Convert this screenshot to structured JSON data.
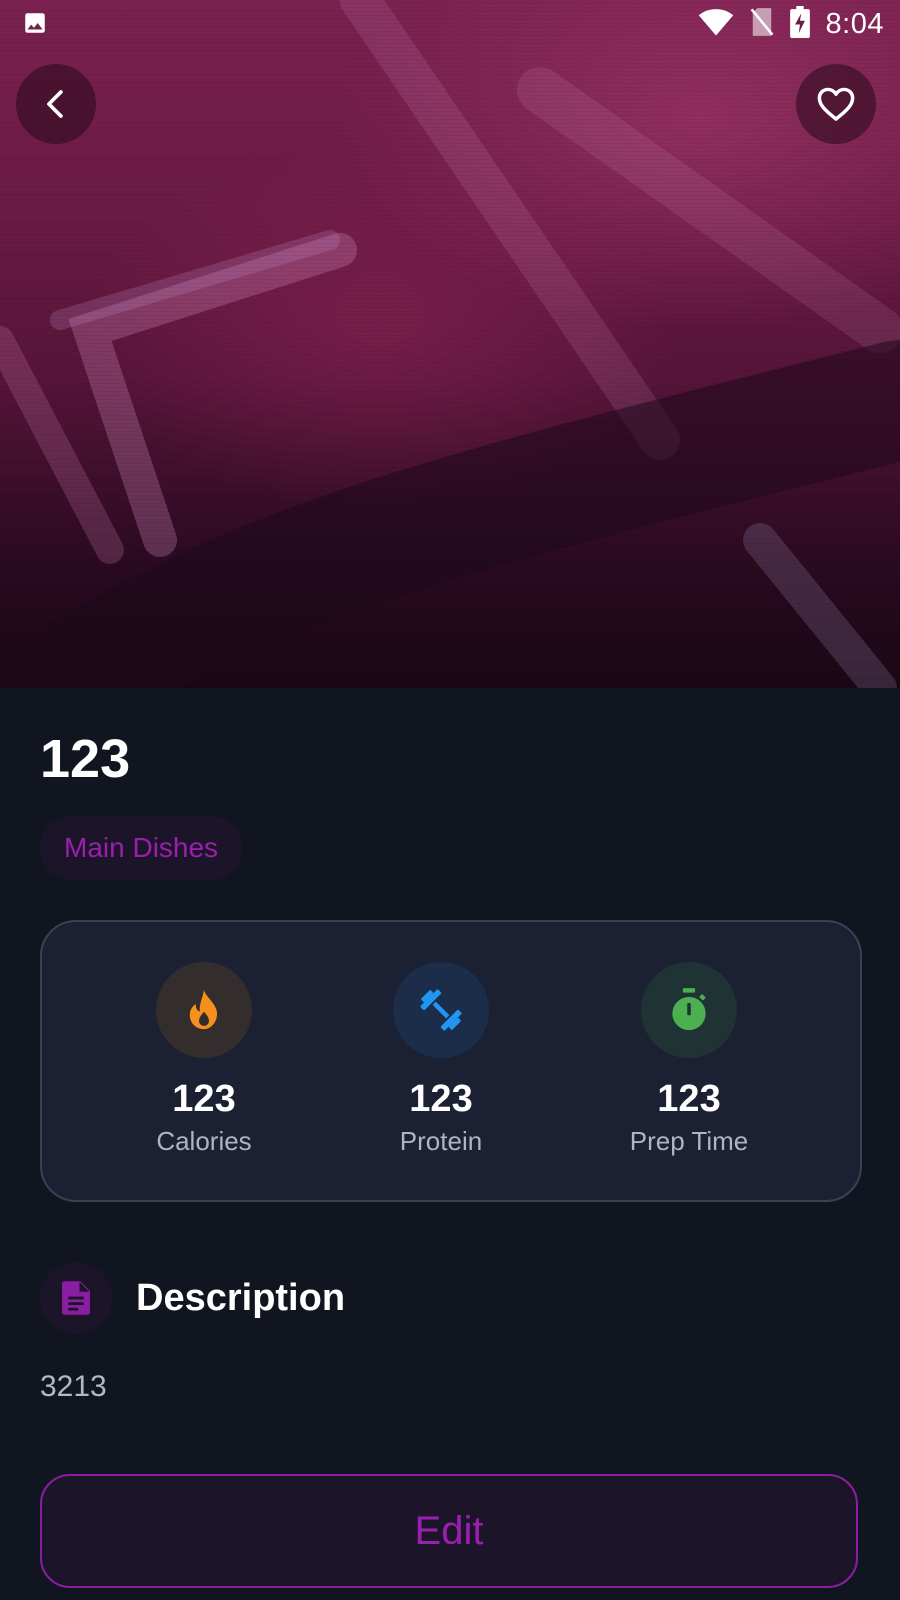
{
  "status_bar": {
    "time": "8:04",
    "icons": [
      "image-notification-icon",
      "wifi-icon",
      "no-sim-icon",
      "battery-charging-icon"
    ]
  },
  "header": {
    "back_icon": "chevron-left-icon",
    "favorite_icon": "heart-outline-icon"
  },
  "recipe": {
    "title": "123",
    "category": "Main Dishes"
  },
  "stats": [
    {
      "value": "123",
      "label": "Calories",
      "icon": "fire-icon",
      "color": "#f5901e"
    },
    {
      "value": "123",
      "label": "Protein",
      "icon": "dumbbell-icon",
      "color": "#2196f3"
    },
    {
      "value": "123",
      "label": "Prep Time",
      "icon": "stopwatch-icon",
      "color": "#4caf50"
    }
  ],
  "description": {
    "title": "Description",
    "icon": "document-icon",
    "text": "3213"
  },
  "actions": {
    "edit_label": "Edit"
  },
  "colors": {
    "accent": "#9a1fb0",
    "background": "#111520",
    "card": "#1b2132"
  }
}
